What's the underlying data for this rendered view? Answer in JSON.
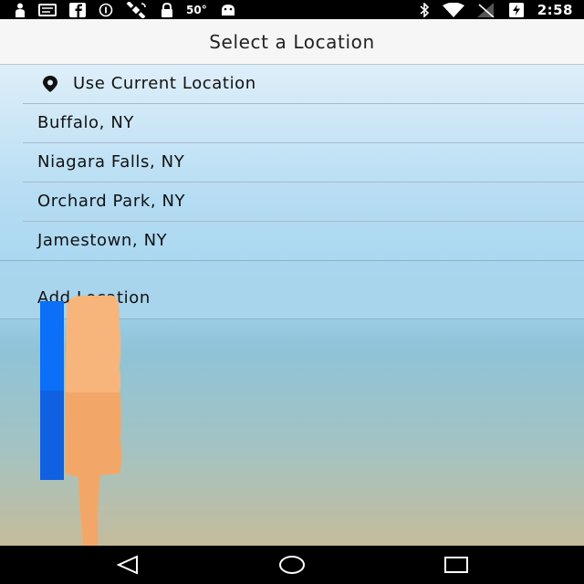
{
  "status_bar": {
    "temperature": "50°",
    "time": "2:58",
    "icons": [
      "person-icon",
      "message-icon",
      "facebook-icon",
      "circle-info-icon",
      "satellite-icon",
      "lock-icon",
      "android-icon",
      "bluetooth-icon",
      "wifi-icon",
      "signal-icon",
      "battery-charging-icon"
    ]
  },
  "header": {
    "title": "Select a Location"
  },
  "locations": {
    "current": "Use Current Location",
    "items": [
      "Buffalo, NY",
      "Niagara Falls, NY",
      "Orchard Park, NY",
      "Jamestown, NY"
    ],
    "add": "Add Location"
  },
  "nav_bar": {
    "buttons": [
      "back-icon",
      "home-icon",
      "recents-icon"
    ]
  },
  "colors": {
    "overlay_bar": "#0b6ff7",
    "overlay_hand": "#f7b57c",
    "title_bg": "#f6f6f6"
  }
}
